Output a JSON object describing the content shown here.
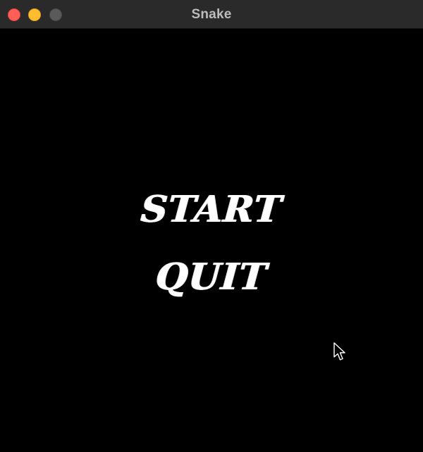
{
  "window": {
    "title": "Snake",
    "traffic_lights": {
      "close_color": "#ff5f57",
      "minimize_color": "#febc2e",
      "zoom_color": "#5b5a5b"
    }
  },
  "game": {
    "background_color": "#000000",
    "text_color": "#ffffff",
    "menu": {
      "start_label": "START",
      "quit_label": "QUIT"
    }
  },
  "cursor": {
    "icon": "arrow-pointer-icon"
  }
}
